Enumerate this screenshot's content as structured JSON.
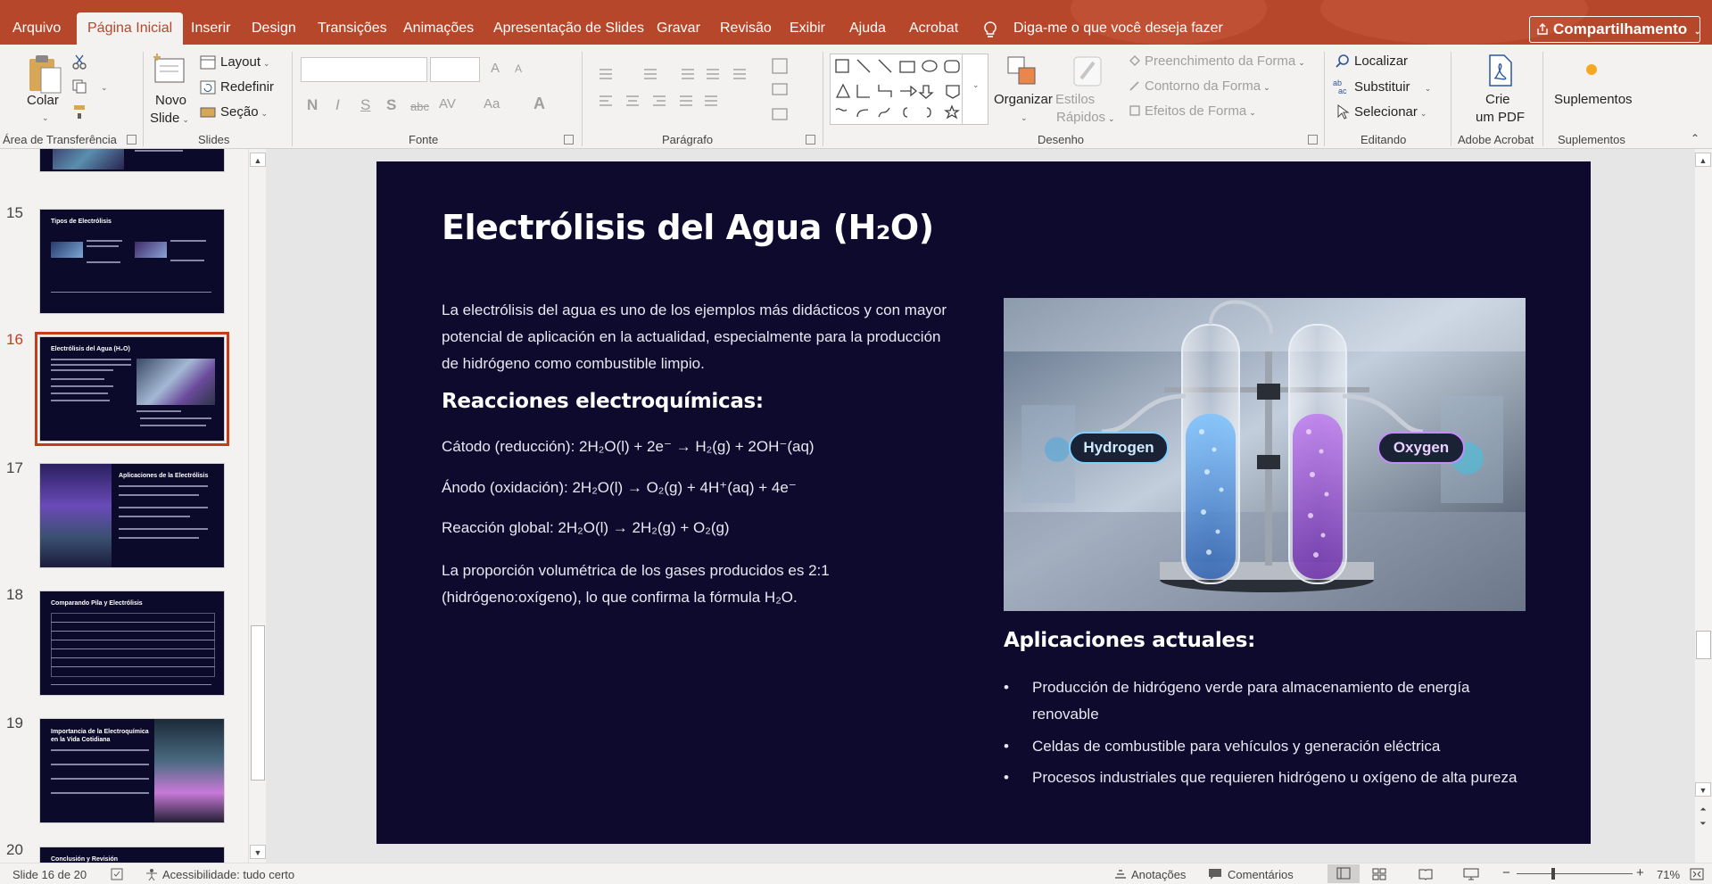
{
  "tabs": [
    "Arquivo",
    "Página Inicial",
    "Inserir",
    "Design",
    "Transições",
    "Animações",
    "Apresentação de Slides",
    "Gravar",
    "Revisão",
    "Exibir",
    "Ajuda",
    "Acrobat"
  ],
  "active_tab": "Página Inicial",
  "tell_me": "Diga-me o que você deseja fazer",
  "share_label": "Compartilhamento",
  "ribbon": {
    "clipboard": {
      "paste": "Colar",
      "group": "Área de Transferência"
    },
    "slides": {
      "new_slide_1": "Novo",
      "new_slide_2": "Slide",
      "layout": "Layout",
      "reset": "Redefinir",
      "section": "Seção",
      "group": "Slides"
    },
    "font": {
      "group": "Fonte",
      "bold": "N",
      "italic": "I",
      "underline": "S",
      "shadow": "S",
      "strike": "abc",
      "spacing": "AV",
      "case": "Aa",
      "color": "A",
      "grow": "A",
      "shrink": "A"
    },
    "paragraph": {
      "group": "Parágrafo"
    },
    "drawing": {
      "arrange": "Organizar",
      "styles_1": "Estilos",
      "styles_2": "Rápidos",
      "fill": "Preenchimento da Forma",
      "outline": "Contorno da Forma",
      "effects": "Efeitos de Forma",
      "group": "Desenho"
    },
    "editing": {
      "find": "Localizar",
      "replace": "Substituir",
      "select": "Selecionar",
      "group": "Editando"
    },
    "acrobat": {
      "create_1": "Crie",
      "create_2": "um PDF",
      "group": "Adobe Acrobat"
    },
    "addins": {
      "label": "Suplementos",
      "group": "Suplementos"
    }
  },
  "thumbnails": [
    {
      "num": "15",
      "title": "Tipos de Electrólisis"
    },
    {
      "num": "16",
      "title": "Electrólisis del Agua (H₂O)"
    },
    {
      "num": "17",
      "title": "Aplicaciones de la Electrólisis"
    },
    {
      "num": "18",
      "title": "Comparando Pila y Electrólisis"
    },
    {
      "num": "19",
      "title": "Importancia de la Electroquímica en la Vida Cotidiana"
    },
    {
      "num": "20",
      "title": "Conclusión y Revisión"
    }
  ],
  "slide": {
    "title": "Electrólisis del Agua (H₂O)",
    "intro": "La electrólisis del agua es uno de los ejemplos más didácticos y con mayor potencial de aplicación en la actualidad, especialmente para la producción de hidrógeno como combustible limpio.",
    "reactions_heading": "Reacciones electroquímicas:",
    "cathode": "Cátodo (reducción): 2H₂O(l) + 2e⁻ → H₂(g) + 2OH⁻(aq)",
    "anode": "Ánodo (oxidación): 2H₂O(l) → O₂(g) + 4H⁺(aq) + 4e⁻",
    "global": "Reacción global: 2H₂O(l) → 2H₂(g) + O₂(g)",
    "ratio": "La proporción volumétrica de los gases producidos es 2:1 (hidrógeno:oxígeno), lo que confirma la fórmula H₂O.",
    "image_label_left": "Hydrogen",
    "image_label_right": "Oxygen",
    "applications_heading": "Aplicaciones actuales:",
    "applications": [
      "Producción de hidrógeno verde para almacenamiento de energía renovable",
      "Celdas de combustible para vehículos y generación eléctrica",
      "Procesos industriales que requieren hidrógeno u oxígeno de alta pureza"
    ]
  },
  "status": {
    "slide_info": "Slide 16 de 20",
    "accessibility": "Acessibilidade: tudo certo",
    "notes": "Anotações",
    "comments": "Comentários",
    "zoom": "71%",
    "minus": "−",
    "plus": "+"
  },
  "colors": {
    "accent": "#b7472a",
    "slide_bg": "#0d0a2d",
    "selection": "#c43e1c"
  }
}
